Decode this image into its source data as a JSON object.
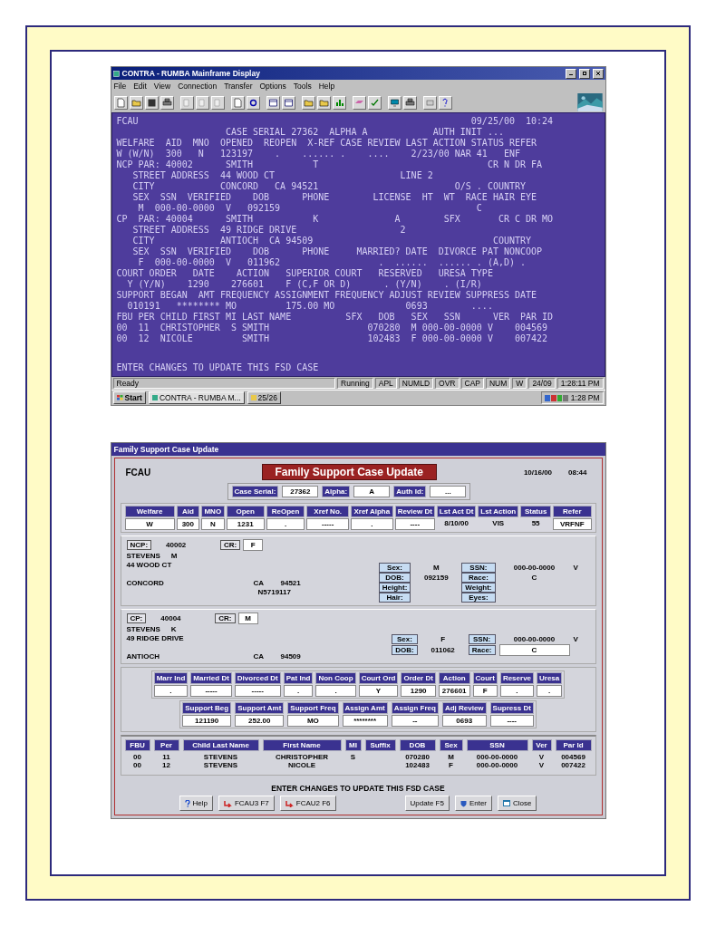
{
  "mainframe": {
    "title": "CONTRA - RUMBA Mainframe Display",
    "menu": [
      "File",
      "Edit",
      "View",
      "Connection",
      "Transfer",
      "Options",
      "Tools",
      "Help"
    ],
    "lines": [
      "FCAU                                                             09/25/00  10:24",
      "                    CASE SERIAL 27362  ALPHA A            AUTH INIT ...",
      "WELFARE  AID  MNO  OPENED  REOPEN  X-REF CASE REVIEW LAST ACTION STATUS REFER",
      "W (W/N)  300   N   123197    .    ...... .    ....    2/23/00 NAR 41   ENF",
      "NCP PAR: 40002      SMITH           T                               CR N DR FA",
      "   STREET ADDRESS  44 WOOD CT                       LINE 2",
      "   CITY            CONCORD   CA 94521                         O/S . COUNTRY",
      "   SEX  SSN  VERIFIED    DOB      PHONE        LICENSE  HT  WT  RACE HAIR EYE",
      "    M  000-00-0000  V   092159                                    C",
      "CP  PAR: 40004      SMITH           K              A        SFX       CR C DR MO",
      "   STREET ADDRESS  49 RIDGE DRIVE                   2",
      "   CITY            ANTIOCH  CA 94509                                 COUNTRY",
      "   SEX  SSN  VERIFIED    DOB      PHONE     MARRIED? DATE  DIVORCE PAT NONCOOP",
      "    F  000-00-0000  V   011962                  .  ......  ...... . (A,D) .",
      "COURT ORDER   DATE    ACTION   SUPERIOR COURT   RESERVED   URESA TYPE",
      "  Y (Y/N)    1290    276601    F (C,F OR D)      . (Y/N)    . (I/R)",
      "SUPPORT BEGAN  AMT FREQUENCY ASSIGNMENT FREQUENCY ADJUST REVIEW SUPPRESS DATE",
      "  010191   ******** MO         175.00 MO             0693        ....",
      "FBU PER CHILD FIRST MI LAST NAME          SFX   DOB   SEX   SSN      VER  PAR ID",
      "00  11  CHRISTOPHER  S SMITH                  070280  M 000-00-0000 V    004569",
      "00  12  NICOLE         SMITH                  102483  F 000-00-0000 V    007422"
    ],
    "message": "ENTER CHANGES TO UPDATE THIS FSD CASE",
    "status_bar": [
      "Ready",
      "Running",
      "APL",
      "NUMLD",
      "OVR",
      "CAP",
      "NUM",
      "W",
      "24/09",
      "1:28:11 PM"
    ],
    "taskbar": {
      "start": "Start",
      "tasks": [
        "CONTRA - RUMBA M...",
        "25/26"
      ],
      "clock": "1:28 PM"
    }
  },
  "form": {
    "window_title": "Family Support Case Update",
    "code": "FCAU",
    "heading": "Family Support Case Update",
    "date": "10/16/00",
    "time": "08:44",
    "case_fields": [
      {
        "label": "Case Serial:",
        "value": "27362"
      },
      {
        "label": "Alpha:",
        "value": "A"
      },
      {
        "label": "Auth Id:",
        "value": "..."
      }
    ],
    "top_grid": [
      {
        "label": "Welfare",
        "value": "W",
        "boxed": true
      },
      {
        "label": "Aid",
        "value": "300",
        "boxed": true
      },
      {
        "label": "MNO",
        "value": "N",
        "boxed": true
      },
      {
        "label": "Open",
        "value": "1231",
        "boxed": true
      },
      {
        "label": "ReOpen",
        "value": ".",
        "boxed": true
      },
      {
        "label": "Xref No.",
        "value": "-----",
        "boxed": true
      },
      {
        "label": "Xref Alpha",
        "value": ".",
        "boxed": true
      },
      {
        "label": "Review Dt",
        "value": "----",
        "boxed": true
      },
      {
        "label": "Lst Act Dt",
        "value": "8/10/00",
        "boxed": false
      },
      {
        "label": "Lst Action",
        "value": "VIS",
        "boxed": false
      },
      {
        "label": "Status",
        "value": "55",
        "boxed": false
      },
      {
        "label": "Refer",
        "value": "VRFNF",
        "boxed": true
      }
    ],
    "ncp": {
      "label": "NCP:",
      "id": "40002",
      "cr_label": "CR:",
      "cr": "F",
      "name": "STEVENS",
      "mi": "M",
      "street": "44 WOOD CT",
      "city": "CONCORD",
      "state": "CA",
      "zip": "94521",
      "license": "N5719117",
      "verified": "V",
      "attrs": [
        {
          "label": "Sex:",
          "value": "M",
          "boxed": false
        },
        {
          "label": "SSN:",
          "value": "000-00-0000",
          "boxed": false
        },
        {
          "label": "DOB:",
          "value": "092159",
          "boxed": false
        },
        {
          "label": "Race:",
          "value": "C",
          "boxed": false
        },
        {
          "label": "Height:"
        },
        {
          "label": "Weight:"
        },
        {
          "label": "Hair:"
        },
        {
          "label": "Eyes:"
        }
      ]
    },
    "cp": {
      "label": "CP:",
      "id": "40004",
      "cr_label": "CR:",
      "cr": "M",
      "name": "STEVENS",
      "mi": "K",
      "street": "49 RIDGE DRIVE",
      "city": "ANTIOCH",
      "state": "CA",
      "zip": "94509",
      "verified": "V",
      "attrs": [
        {
          "label": "Sex:",
          "value": "F",
          "boxed": false
        },
        {
          "label": "SSN:",
          "value": "000-00-0000",
          "boxed": false
        },
        {
          "label": "DOB:",
          "value": "011062",
          "boxed": false
        },
        {
          "label": "Race:",
          "value": "C",
          "boxed": true
        }
      ]
    },
    "court_grid": [
      {
        "label": "Marr Ind",
        "value": "."
      },
      {
        "label": "Married Dt",
        "value": "-----"
      },
      {
        "label": "Divorced Dt",
        "value": "-----"
      },
      {
        "label": "Pat Ind",
        "value": "."
      },
      {
        "label": "Non Coop",
        "value": "."
      },
      {
        "label": "Court Ord",
        "value": "Y"
      },
      {
        "label": "Order Dt",
        "value": "1290"
      },
      {
        "label": "Action",
        "value": "276601"
      },
      {
        "label": "Court",
        "value": "F"
      },
      {
        "label": "Reserve",
        "value": "."
      },
      {
        "label": "Uresa",
        "value": "."
      }
    ],
    "support_grid": [
      {
        "label": "Support Beg",
        "value": "121190"
      },
      {
        "label": "Support Amt",
        "value": "252.00"
      },
      {
        "label": "Support Freq",
        "value": "MO"
      },
      {
        "label": "Assign Amt",
        "value": "********"
      },
      {
        "label": "Assign Freq",
        "value": "--"
      },
      {
        "label": "Adj Review",
        "value": "0693"
      },
      {
        "label": "Supress Dt",
        "value": "----"
      }
    ],
    "children": {
      "columns": [
        "FBU",
        "Per",
        "Child Last Name",
        "First Name",
        "MI",
        "Suffix",
        "DOB",
        "Sex",
        "SSN",
        "Ver",
        "Par Id"
      ],
      "rows": [
        {
          "fbu": "00",
          "per": "11",
          "last": "STEVENS",
          "first": "CHRISTOPHER",
          "mi": "S",
          "dob": "070280",
          "sex": "M",
          "ssn": "000-00-0000",
          "ver": "V",
          "par_id": "004569"
        },
        {
          "fbu": "00",
          "per": "12",
          "last": "STEVENS",
          "first": "NICOLE",
          "dob": "102483",
          "sex": "F",
          "ssn": "000-00-0000",
          "ver": "V",
          "par_id": "007422"
        }
      ]
    },
    "message": "ENTER CHANGES TO UPDATE THIS FSD CASE",
    "buttons": [
      "Help",
      "FCAU3 F7",
      "FCAU2 F6",
      "Update F5",
      "Enter",
      "Close"
    ]
  }
}
